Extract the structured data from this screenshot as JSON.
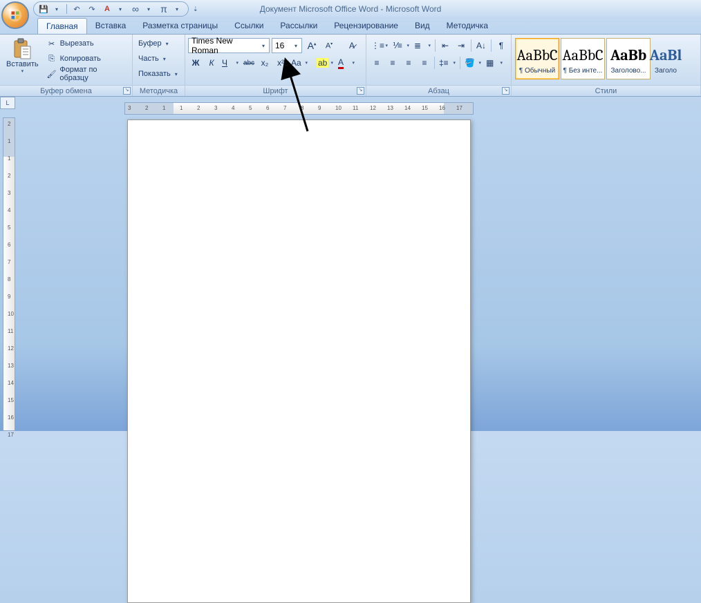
{
  "title": "Документ Microsoft Office Word - Microsoft Word",
  "qat": {
    "save": "💾",
    "undo": "↶",
    "redo": "↷",
    "style": "A",
    "infinity": "∞",
    "pi": "π"
  },
  "tabs": [
    "Главная",
    "Вставка",
    "Разметка страницы",
    "Ссылки",
    "Рассылки",
    "Рецензирование",
    "Вид",
    "Методичка"
  ],
  "clipboard": {
    "paste": "Вставить",
    "cut": "Вырезать",
    "copy": "Копировать",
    "format": "Формат по образцу",
    "label": "Буфер обмена"
  },
  "method": {
    "buffer": "Буфер",
    "part": "Часть",
    "show": "Показать",
    "label": "Методичка"
  },
  "font": {
    "name": "Times New Roman",
    "size": "16",
    "label": "Шрифт",
    "bold": "Ж",
    "italic": "К",
    "under": "Ч",
    "strike": "abc",
    "sub": "x₂",
    "sup": "x²",
    "case": "Aa",
    "grow": "A",
    "shrink": "A",
    "clear": "⌫",
    "hl": "ab",
    "color": "A"
  },
  "para": {
    "label": "Абзац",
    "bul": "≣",
    "num": "1≡",
    "multi": "⊟",
    "dedent": "⇤",
    "indent": "⇥",
    "sort": "A↓",
    "pilcrow": "¶",
    "al": "≡",
    "ac": "≡",
    "ar": "≡",
    "aj": "≡",
    "ls": "‡",
    "shade": "▦",
    "border": "▦"
  },
  "styles": {
    "label": "Стили",
    "items": [
      {
        "sample": "AaBbC",
        "name": "¶ Обычный"
      },
      {
        "sample": "AaBbC",
        "name": "¶ Без инте..."
      },
      {
        "sample": "AaBb",
        "name": "Заголово..."
      },
      {
        "sample": "AaBl",
        "name": "Заголо"
      }
    ]
  },
  "ruler_h": [
    "3",
    "2",
    "1",
    "1",
    "2",
    "3",
    "4",
    "5",
    "6",
    "7",
    "8",
    "9",
    "10",
    "11",
    "12",
    "13",
    "14",
    "15",
    "16",
    "17"
  ],
  "ruler_v": [
    "2",
    "1",
    "1",
    "2",
    "3",
    "4",
    "5",
    "6",
    "7",
    "8",
    "9",
    "10",
    "11",
    "12",
    "13",
    "14",
    "15",
    "16",
    "17"
  ]
}
